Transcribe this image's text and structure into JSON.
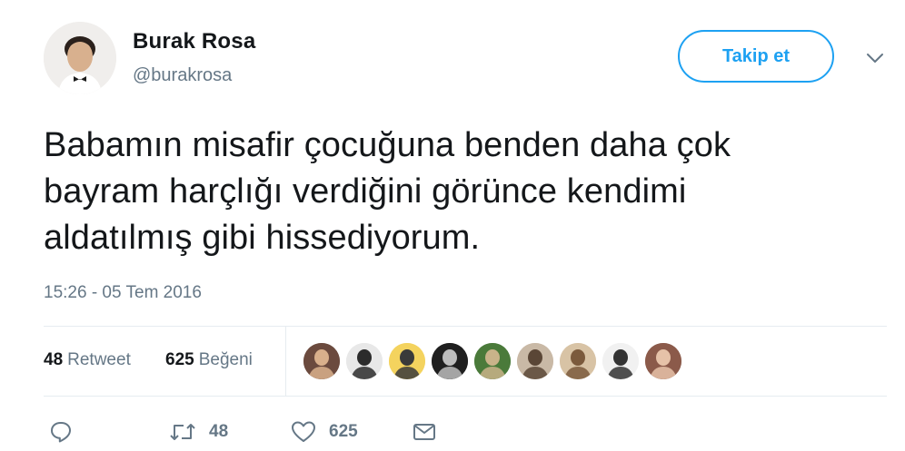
{
  "user": {
    "name": "Burak Rosa",
    "handle": "@burakrosa"
  },
  "follow_button": {
    "label": "Takip et"
  },
  "tweet": {
    "lines": [
      "Babamın misafir çocuğuna benden daha çok",
      "bayram harçlığı verdiğini görünce kendimi",
      "aldatılmış gibi hissediyorum."
    ],
    "timestamp": "15:26 - 05 Tem 2016"
  },
  "stats": {
    "retweets": {
      "count": "48",
      "label": "Retweet"
    },
    "likes": {
      "count": "625",
      "label": "Beğeni"
    }
  },
  "likers": [
    {
      "name": "liker-1-avatar",
      "bg": "#6b4a3e",
      "fg": "#d9b08c"
    },
    {
      "name": "liker-2-avatar",
      "bg": "#e8e8e8",
      "fg": "#2b2b2b"
    },
    {
      "name": "liker-3-avatar",
      "bg": "#f4d35e",
      "fg": "#3a3a3a"
    },
    {
      "name": "liker-4-avatar",
      "bg": "#1f1f1f",
      "fg": "#bdbdbd"
    },
    {
      "name": "liker-5-avatar",
      "bg": "#4a7a3a",
      "fg": "#c9b38a"
    },
    {
      "name": "liker-6-avatar",
      "bg": "#c9b9a6",
      "fg": "#5a4636"
    },
    {
      "name": "liker-7-avatar",
      "bg": "#d8c3a5",
      "fg": "#7b5a3c"
    },
    {
      "name": "liker-8-avatar",
      "bg": "#f1f1f1",
      "fg": "#333333"
    },
    {
      "name": "liker-9-avatar",
      "bg": "#8b5a4a",
      "fg": "#e6c2a8"
    }
  ],
  "actions": {
    "reply": {
      "icon": "reply-icon",
      "count": ""
    },
    "retweet": {
      "icon": "retweet-icon",
      "count": "48"
    },
    "like": {
      "icon": "heart-icon",
      "count": "625"
    },
    "message": {
      "icon": "envelope-icon",
      "count": ""
    }
  },
  "colors": {
    "accent": "#1da1f2",
    "muted": "#657786",
    "text": "#14171a",
    "divider": "#e6ecf0"
  }
}
